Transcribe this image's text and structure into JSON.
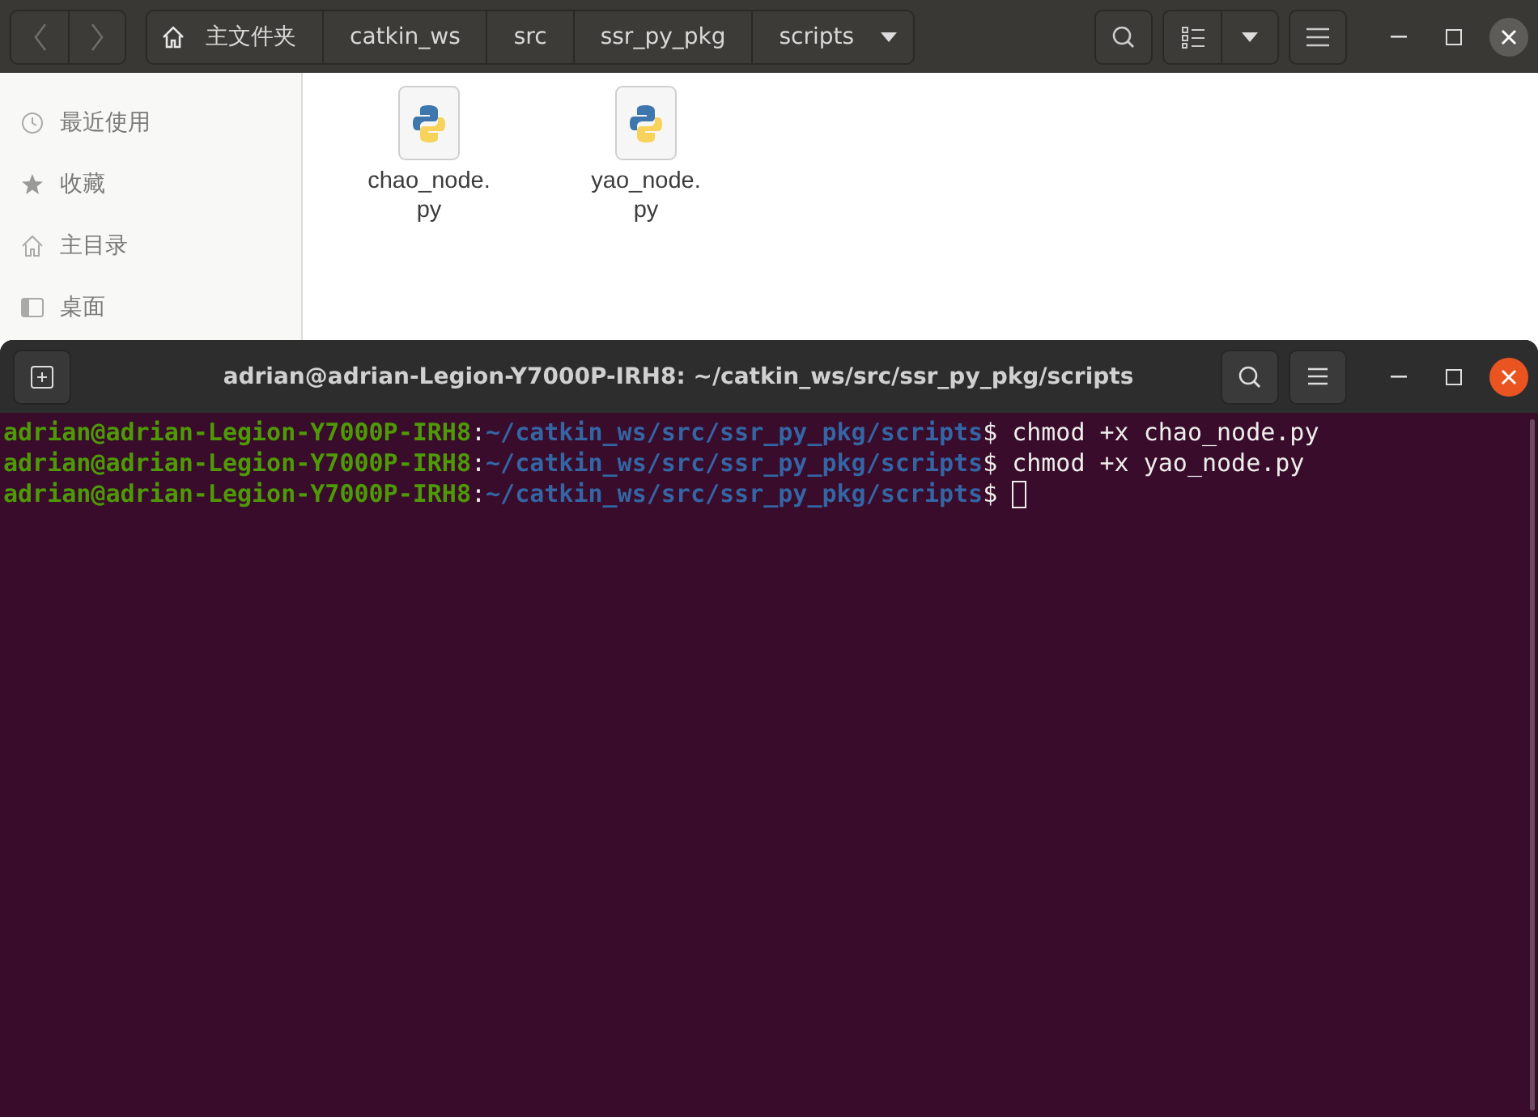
{
  "file_manager": {
    "breadcrumbs": [
      {
        "kind": "home",
        "label": "主文件夹"
      },
      {
        "kind": "folder",
        "label": "catkin_ws"
      },
      {
        "kind": "folder",
        "label": "src"
      },
      {
        "kind": "folder",
        "label": "ssr_py_pkg"
      },
      {
        "kind": "folder",
        "label": "scripts"
      }
    ],
    "sidebar": {
      "items": [
        {
          "kind": "recent",
          "label": "最近使用"
        },
        {
          "kind": "starred",
          "label": "收藏"
        },
        {
          "kind": "home",
          "label": "主目录"
        },
        {
          "kind": "desktop",
          "label": "桌面"
        }
      ]
    },
    "files": [
      {
        "name": "chao_node.py"
      },
      {
        "name": "yao_node.py"
      }
    ]
  },
  "terminal": {
    "title": "adrian@adrian-Legion-Y7000P-IRH8: ~/catkin_ws/src/ssr_py_pkg/scripts",
    "cursor": true,
    "lines": [
      {
        "user_host": "adrian@adrian-Legion-Y7000P-IRH8",
        "colon": ":",
        "path": "~/catkin_ws/src/ssr_py_pkg/scripts",
        "prompt": "$",
        "command": "chmod +x chao_node.py"
      },
      {
        "user_host": "adrian@adrian-Legion-Y7000P-IRH8",
        "colon": ":",
        "path": "~/catkin_ws/src/ssr_py_pkg/scripts",
        "prompt": "$",
        "command": "chmod +x yao_node.py"
      },
      {
        "user_host": "adrian@adrian-Legion-Y7000P-IRH8",
        "colon": ":",
        "path": "~/catkin_ws/src/ssr_py_pkg/scripts",
        "prompt": "$"
      }
    ]
  }
}
